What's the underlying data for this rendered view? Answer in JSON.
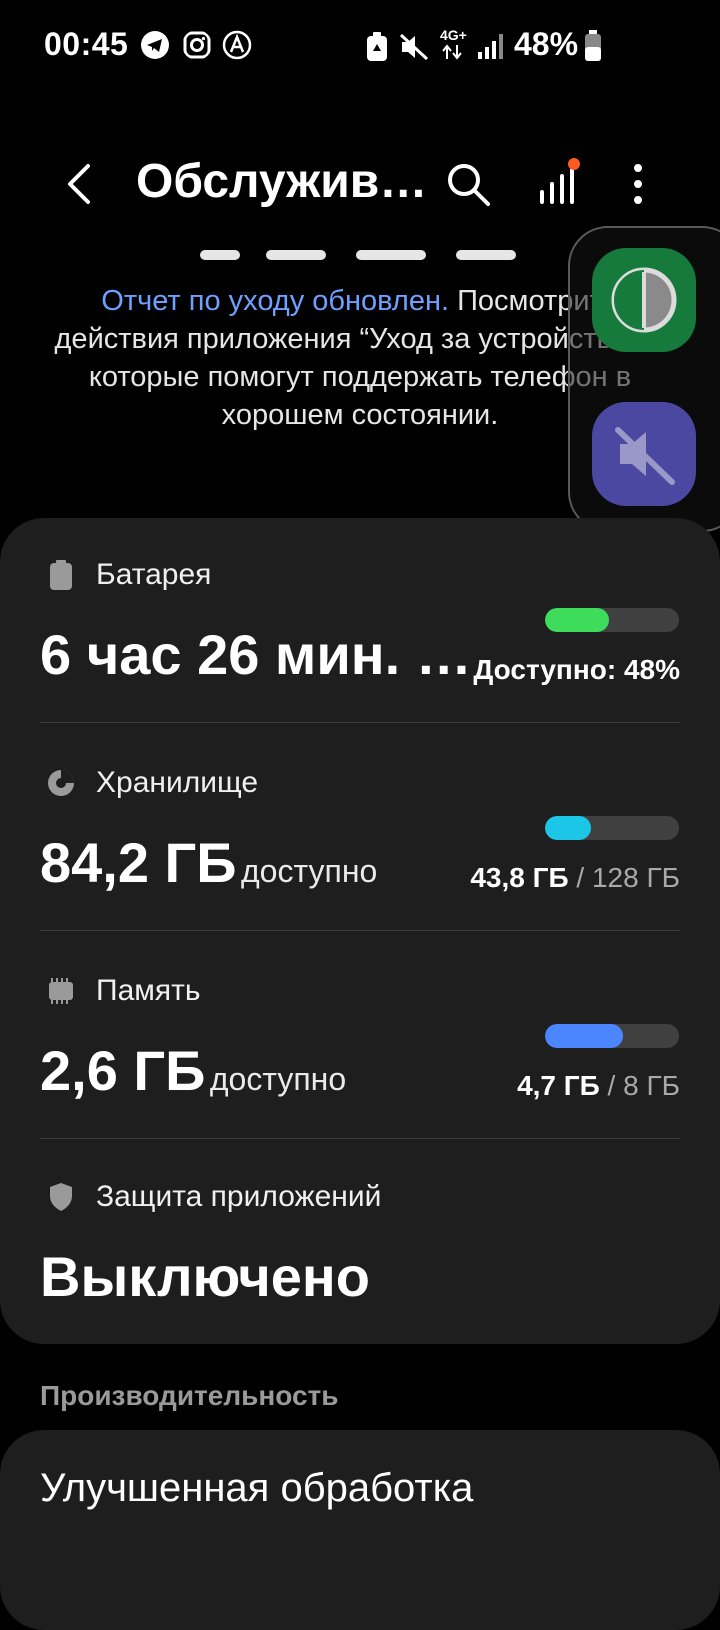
{
  "status_bar": {
    "time": "00:45",
    "battery_percent": "48%",
    "network": "4G+",
    "icons": [
      "telegram-icon",
      "instagram-icon",
      "app-a-icon",
      "battery-saver-icon",
      "mute-icon",
      "network-4g-icon",
      "signal-icon",
      "battery-icon"
    ]
  },
  "app_bar": {
    "title": "Обслужив…",
    "icons": [
      "back-icon",
      "search-icon",
      "signal-bars-icon",
      "more-icon"
    ],
    "badge_color": "#ff5a1f"
  },
  "description": {
    "link_text": "Отчет по уходу обновлен.",
    "body_text": " Посмотрите действия приложения “Уход за устройством”, которые помогут поддержать телефон в хорошем состоянии."
  },
  "floating_panel": {
    "buttons": [
      "timer-icon",
      "mute-icon"
    ],
    "colors": [
      "#157a3c",
      "#4a48a0"
    ]
  },
  "battery": {
    "label": "Батарея",
    "value": "6 час 26 мин. …",
    "available_text": "Доступно: 48%",
    "level": 48,
    "color": "#3ddc5b"
  },
  "storage": {
    "label": "Хранилище",
    "value": "84,2 ГБ",
    "unit": "доступно",
    "used": "43,8 ГБ",
    "separator": " / ",
    "total": "128 ГБ",
    "level": 34,
    "color": "#1cc6e6"
  },
  "memory": {
    "label": "Память",
    "value": "2,6 ГБ",
    "unit": "доступно",
    "used": "4,7 ГБ",
    "separator": " / ",
    "total": "8 ГБ",
    "level": 58,
    "color": "#4c86ff"
  },
  "app_protection": {
    "label": "Защита приложений",
    "value": "Выключено"
  },
  "performance": {
    "section_title": "Производительность",
    "item_title": "Улучшенная обработка"
  }
}
